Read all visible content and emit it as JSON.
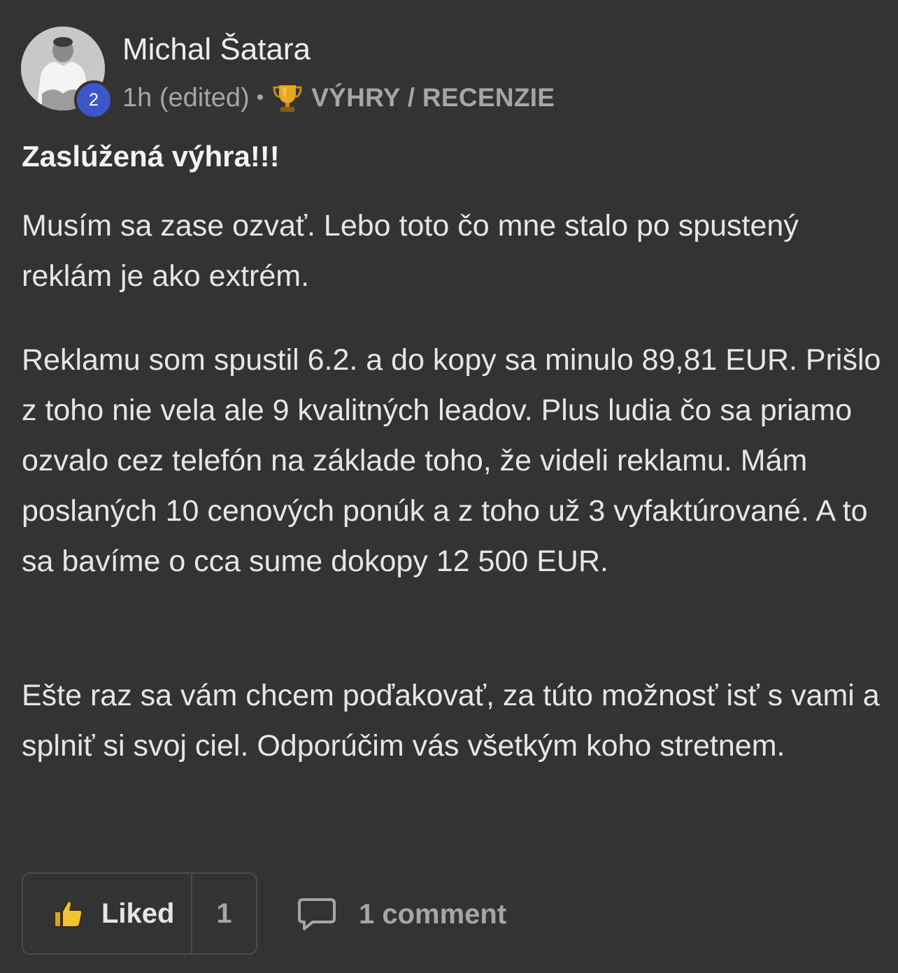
{
  "author": {
    "name": "Michal Šatara",
    "level": "2"
  },
  "meta": {
    "time": "1h (edited)",
    "separator": "•",
    "category": "VÝHRY / RECENZIE"
  },
  "post": {
    "title": "Zaslúžená výhra!!!",
    "paragraphs": [
      "Musím sa zase ozvať. Lebo toto čo mne stalo po spustený reklám je ako extrém.",
      "Reklamu som spustil 6.2. a do kopy sa minulo 89,81 EUR. Prišlo z toho nie vela ale 9 kvalitných leadov. Plus ludia čo sa priamo ozvalo cez telefón na základe toho, že videli reklamu. Mám poslaných 10 cenových ponúk a z toho už 3 vyfaktúrované. A to sa bavíme o cca sume dokopy 12 500 EUR.",
      "Ešte raz sa vám chcem poďakovať, za túto možnosť isť s vami a splniť si svoj ciel. Odporúčim vás všetkým koho stretnem."
    ]
  },
  "footer": {
    "like_label": "Liked",
    "like_count": "1",
    "comment_label": "1 comment"
  },
  "icons": {
    "trophy": "trophy-icon",
    "thumb": "thumbs-up-icon",
    "comment": "comment-bubble-icon"
  },
  "colors": {
    "background": "#333333",
    "level_badge": "#3d57c9",
    "trophy_gold": "#e5a823",
    "thumb_yellow": "#f2c230"
  }
}
